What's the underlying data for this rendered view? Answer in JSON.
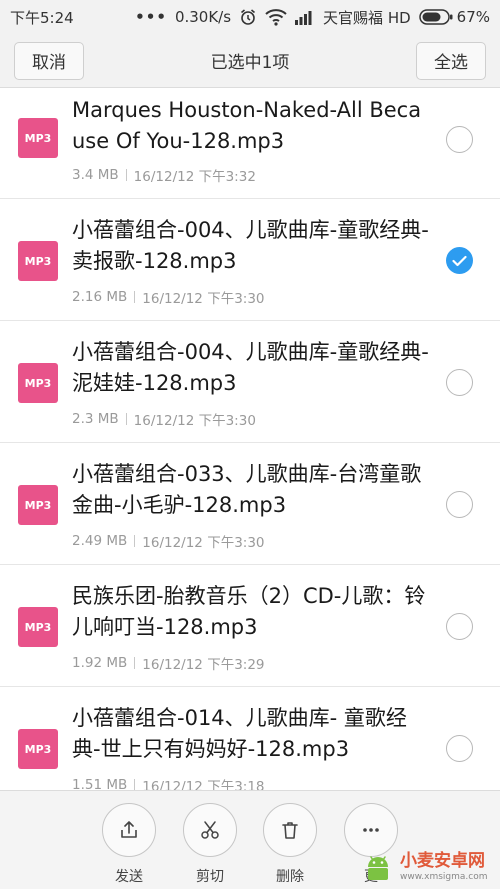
{
  "status_bar": {
    "time": "下午5:24",
    "network_speed": "0.30K/s",
    "carrier": "天官赐福 HD",
    "battery": "67%",
    "icons": [
      "dots-icon",
      "alarm-icon",
      "wifi-icon",
      "signal-icon",
      "battery-icon"
    ]
  },
  "header": {
    "cancel_label": "取消",
    "title": "已选中1项",
    "select_all_label": "全选"
  },
  "files": [
    {
      "type": "MP3",
      "name": "Marques Houston-Naked-All Because Of You-128.mp3",
      "size": "3.4 MB",
      "date": "16/12/12 下午3:32",
      "selected": false
    },
    {
      "type": "MP3",
      "name": "小蓓蕾组合-004、儿歌曲库-童歌经典-卖报歌-128.mp3",
      "size": "2.16 MB",
      "date": "16/12/12 下午3:30",
      "selected": true
    },
    {
      "type": "MP3",
      "name": "小蓓蕾组合-004、儿歌曲库-童歌经典-泥娃娃-128.mp3",
      "size": "2.3 MB",
      "date": "16/12/12 下午3:30",
      "selected": false
    },
    {
      "type": "MP3",
      "name": "小蓓蕾组合-033、儿歌曲库-台湾童歌金曲-小毛驴-128.mp3",
      "size": "2.49 MB",
      "date": "16/12/12 下午3:30",
      "selected": false
    },
    {
      "type": "MP3",
      "name": "民族乐团-胎教音乐（2）CD-儿歌：铃儿响叮当-128.mp3",
      "size": "1.92 MB",
      "date": "16/12/12 下午3:29",
      "selected": false
    },
    {
      "type": "MP3",
      "name": "小蓓蕾组合-014、儿歌曲库- 童歌经典-世上只有妈妈好-128.mp3",
      "size": "1.51 MB",
      "date": "16/12/12 下午3:18",
      "selected": false
    }
  ],
  "actions": [
    {
      "label": "发送",
      "icon": "share-icon"
    },
    {
      "label": "剪切",
      "icon": "scissors-icon"
    },
    {
      "label": "删除",
      "icon": "trash-icon"
    },
    {
      "label": "更",
      "icon": "more-icon"
    }
  ],
  "watermark": {
    "main": "小麦安卓网",
    "sub": "www.xmsigma.com"
  },
  "colors": {
    "accent": "#2d9cf0",
    "mp3_icon": "#e8538a",
    "bar_background": "#f2f2f2"
  }
}
